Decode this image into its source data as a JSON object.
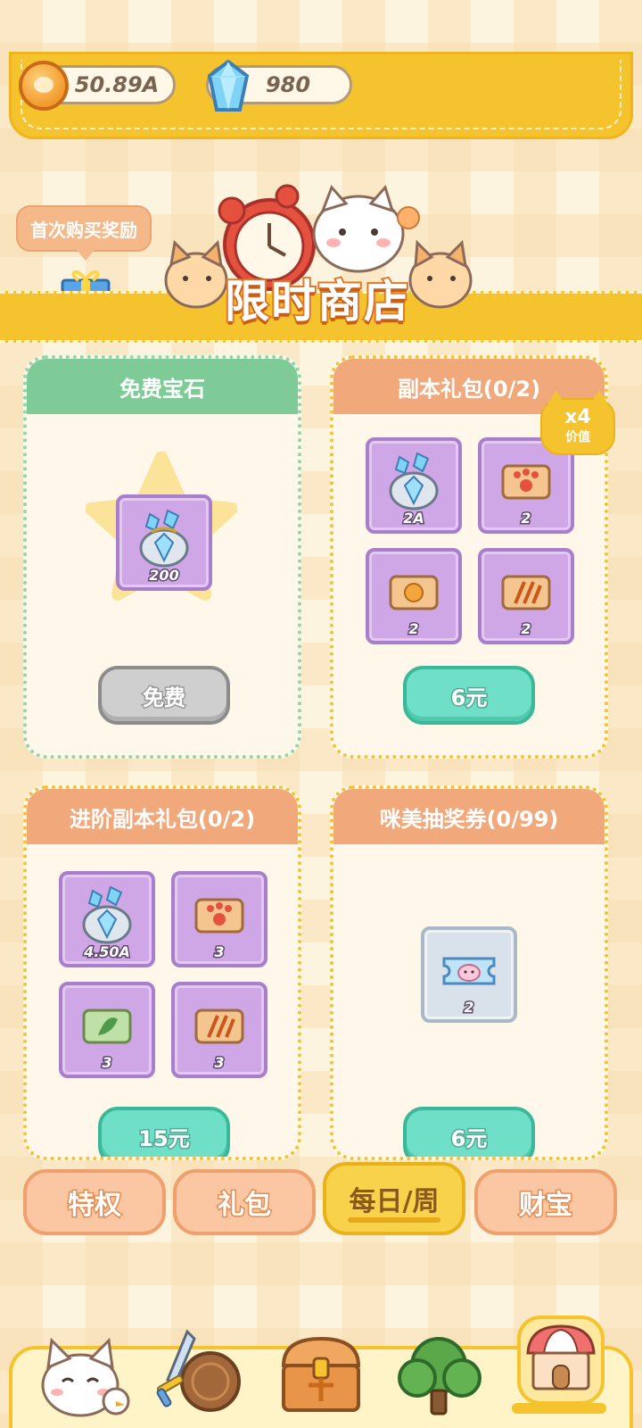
{
  "currency": {
    "coins": "50.89A",
    "gems": "980"
  },
  "first_buy_label": "首次购买奖励",
  "shop_title": "限时商店",
  "cards": [
    {
      "title": "免费宝石",
      "items": [
        {
          "icon": "gem-bag-icon",
          "qty": "200"
        }
      ],
      "button": "免费"
    },
    {
      "title": "副本礼包(0/2)",
      "badge": {
        "multiplier": "x4",
        "label": "价值"
      },
      "items": [
        {
          "icon": "gem-bag-icon",
          "qty": "2A"
        },
        {
          "icon": "paw-ticket-red-icon",
          "qty": "2"
        },
        {
          "icon": "coin-ticket-icon",
          "qty": "2"
        },
        {
          "icon": "stripe-ticket-icon",
          "qty": "2"
        }
      ],
      "button": "6元"
    },
    {
      "title": "进阶副本礼包(0/2)",
      "items": [
        {
          "icon": "gem-bag-icon",
          "qty": "4.50A"
        },
        {
          "icon": "paw-ticket-red-icon",
          "qty": "3"
        },
        {
          "icon": "leaf-ticket-green-icon",
          "qty": "3"
        },
        {
          "icon": "stripe-ticket-icon",
          "qty": "3"
        }
      ],
      "button": "15元"
    },
    {
      "title": "咪美抽奖券(0/99)",
      "items": [
        {
          "icon": "cat-lottery-ticket-icon",
          "qty": "2"
        }
      ],
      "button": "6元"
    }
  ],
  "tabs": [
    {
      "label": "特权",
      "active": false
    },
    {
      "label": "礼包",
      "active": false
    },
    {
      "label": "每日/周",
      "active": true
    },
    {
      "label": "财宝",
      "active": false
    }
  ],
  "bottom_nav": [
    {
      "icon": "cat-home-icon"
    },
    {
      "icon": "sword-shield-icon"
    },
    {
      "icon": "treasure-chest-icon"
    },
    {
      "icon": "tree-icon"
    },
    {
      "icon": "shop-icon",
      "active": true
    }
  ],
  "colors": {
    "accent_yellow": "#f5c32d",
    "header_green": "#7fcb98",
    "header_orange": "#f1a87a",
    "item_purple": "#cfa6e6",
    "button_teal": "#6fe0c7"
  }
}
